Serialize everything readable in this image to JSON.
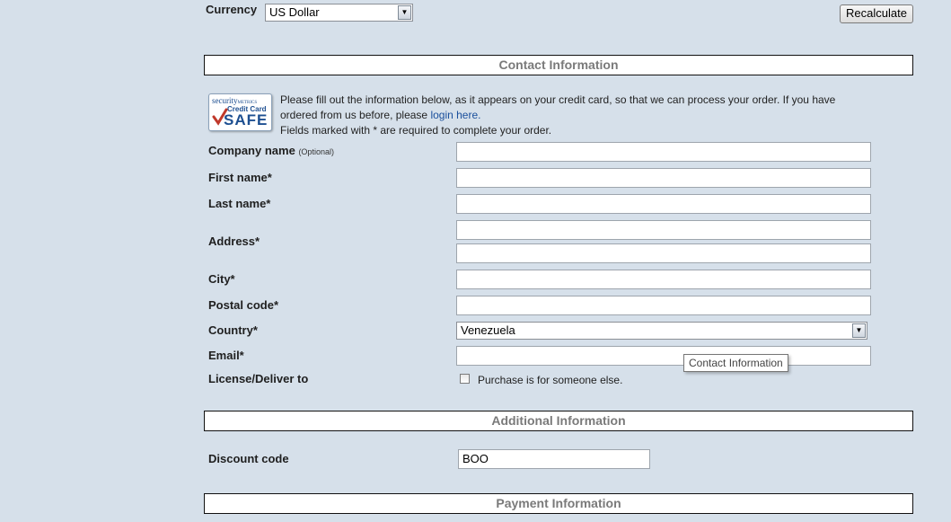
{
  "currency": {
    "label": "Currency",
    "selected": "US Dollar",
    "recalculate_label": "Recalculate"
  },
  "contact": {
    "header": "Contact Information",
    "badge": {
      "line1": "security",
      "line1b": "METRICS",
      "line2": "Credit Card",
      "line3": "SAFE"
    },
    "intro_line1": "Please fill out the information below, as it appears on your credit card, so that we can process your order. If you have",
    "intro_line2_prefix": "ordered from us before, please ",
    "intro_link": "login here",
    "intro_line2_suffix": ".",
    "intro_line3": "Fields marked with * are required to complete your order.",
    "company_label": "Company name",
    "company_optional": "(Optional)",
    "company_value": "",
    "first_name_label": "First name*",
    "first_name_value": "",
    "last_name_label": "Last name*",
    "last_name_value": "",
    "address_label": "Address*",
    "address1_value": "",
    "address2_value": "",
    "city_label": "City*",
    "city_value": "",
    "postal_label": "Postal code*",
    "postal_value": "",
    "country_label": "Country*",
    "country_selected": "Venezuela",
    "email_label": "Email*",
    "email_value": "",
    "license_label": "License/Deliver to",
    "license_checkbox_label": "Purchase is for someone else.",
    "tooltip": "Contact Information"
  },
  "additional": {
    "header": "Additional Information",
    "discount_label": "Discount code",
    "discount_value": "BOO"
  },
  "payment": {
    "header": "Payment Information"
  },
  "colors": {
    "background": "#d6e0ea",
    "section_text": "#7a7a7a",
    "link": "#1a4f9c",
    "badge_red": "#c0392b",
    "badge_blue": "#1d4f91"
  }
}
